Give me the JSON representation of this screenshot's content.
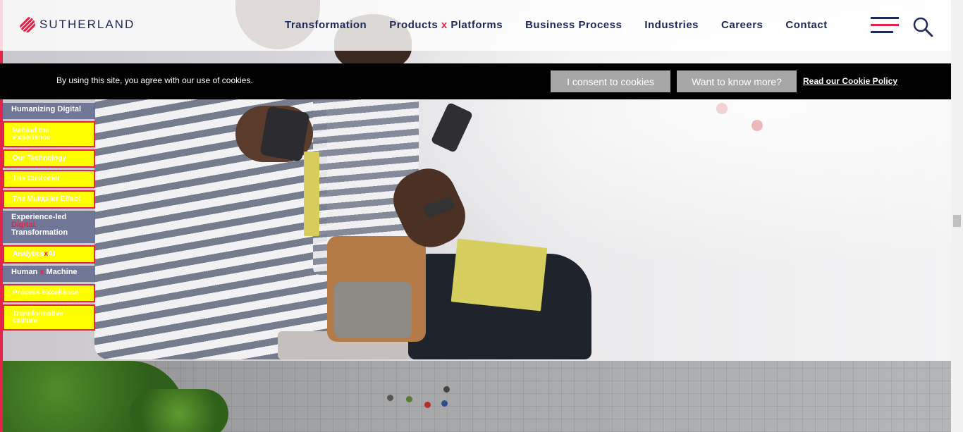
{
  "brand": {
    "name": "SUTHERLAND",
    "accent": "#e4234b",
    "navy": "#20295c"
  },
  "nav": {
    "items": [
      {
        "label": "Transformation"
      },
      {
        "label_pre": "Products ",
        "label_x": "x",
        "label_post": " Platforms"
      },
      {
        "label": "Business Process"
      },
      {
        "label": "Industries"
      },
      {
        "label": "Careers"
      },
      {
        "label": "Contact"
      }
    ],
    "menu_icon": "hamburger-icon",
    "search_icon": "search-icon"
  },
  "cookie": {
    "message": "By using this site, you agree with our use of cookies.",
    "consent_label": "I consent to cookies",
    "more_label": "Want to know more?",
    "policy_label": "Read our Cookie Policy"
  },
  "side_nav": {
    "section1": "Humanizing Digital",
    "items1": [
      "Behind the Experience",
      "Our Technology",
      "The Customer",
      "The Multiplier Effect"
    ],
    "section2_a": "Experience-led",
    "section2_b": "Digital",
    "section2_c": "Transformation",
    "item2_pre": "Analytics ",
    "item2_x": "x",
    "item2_post": " AI",
    "section3_pre": "Human ",
    "section3_x": "x",
    "section3_post": " Machine",
    "items3": [
      "Process Excellence",
      "Transformative Culture"
    ]
  }
}
